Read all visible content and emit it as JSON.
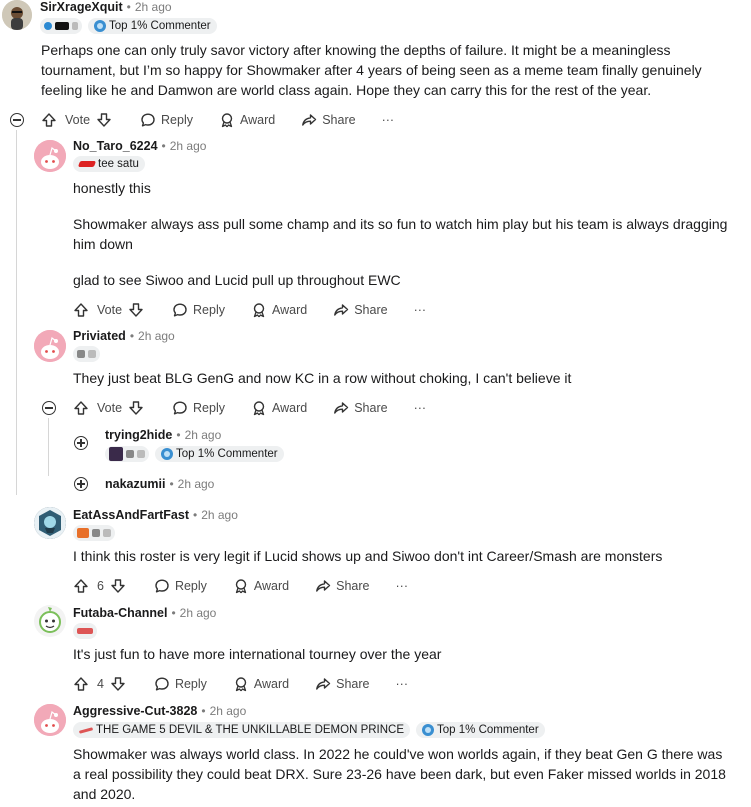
{
  "comments": {
    "c1": {
      "username": "SirXrageXquit",
      "time": "2h ago",
      "badge": "Top 1% Commenter",
      "body": "Perhaps one can only truly savor victory after knowing the depths of failure. It might be a meaningless tournament, but I’m so happy for Showmaker after 4 years of being seen as a meme team finally genuinely feeling like he and Damwon are world class again. Hope they can carry this for the rest of the year.",
      "vote_label": "Vote"
    },
    "c2": {
      "username": "No_Taro_6224",
      "time": "2h ago",
      "flair": "tee satu",
      "body_lines": [
        "honestly this",
        "Showmaker always ass pull some champ and its so fun to watch him play but his team is always dragging him down",
        "glad to see Siwoo and Lucid pull up throughout EWC"
      ],
      "vote_label": "Vote"
    },
    "c3": {
      "username": "Priviated",
      "time": "2h ago",
      "body": "They just beat BLG GenG and now KC in a row without choking, I can't believe it",
      "vote_label": "Vote"
    },
    "c4": {
      "username": "trying2hide",
      "time": "2h ago",
      "badge": "Top 1% Commenter"
    },
    "c5": {
      "username": "nakazumii",
      "time": "2h ago"
    },
    "c6": {
      "username": "EatAssAndFartFast",
      "time": "2h ago",
      "body": "I think this roster is very legit if Lucid shows up and Siwoo don't int Career/Smash are monsters",
      "vote_count": "6"
    },
    "c7": {
      "username": "Futaba-Channel",
      "time": "2h ago",
      "body": "It's just fun to have more international tourney over the year",
      "vote_count": "4"
    },
    "c8": {
      "username": "Aggressive-Cut-3828",
      "time": "2h ago",
      "flair": "THE GAME 5 DEVIL & THE UNKILLABLE DEMON PRINCE",
      "badge": "Top 1% Commenter",
      "body": "Showmaker was always world class. In 2022 he could've won worlds again, if they beat Gen G there was a real possibility they could beat DRX. Sure 23-26 have been dark, but even Faker missed worlds in 2018 and 2020."
    }
  },
  "actions": {
    "reply": "Reply",
    "award": "Award",
    "share": "Share",
    "more": "···"
  },
  "separator": "•",
  "icons": [
    "upvote-icon",
    "downvote-icon",
    "reply-icon",
    "award-icon",
    "share-icon",
    "more-icon",
    "collapse-icon",
    "expand-icon",
    "avatar-icon",
    "top-commenter-badge-icon"
  ],
  "colors": {
    "text": "#1a1a1b",
    "meta": "#7c7c7c",
    "flair_bg": "#eef0f1",
    "thread_line": "#d6d6d6",
    "badge": "#3a8fd1",
    "snoo_avatar": "#f2a9b8"
  }
}
